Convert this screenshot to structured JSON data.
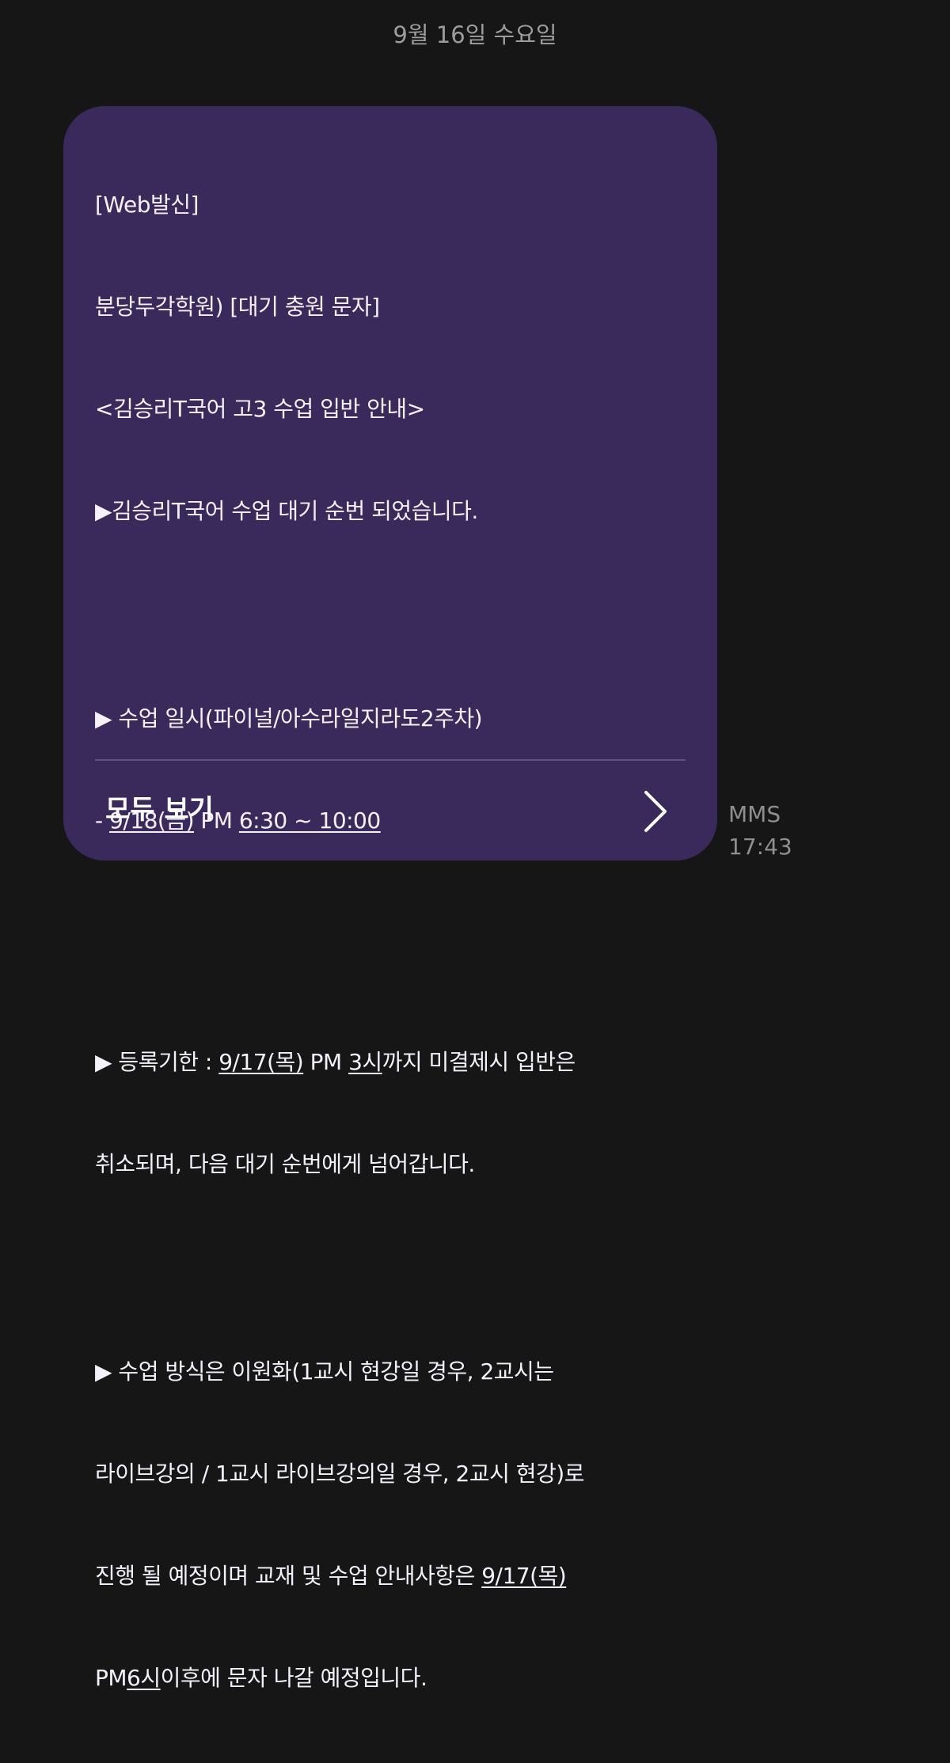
{
  "header": {
    "date": "9월 16일 수요일"
  },
  "message": {
    "line1": "[Web발신]",
    "line2": "분당두각학원) [대기 충원 문자]",
    "line3": "<김승리T국어 고3 수업 입반 안내>",
    "line4": "▶김승리T국어 수업 대기 순번 되었습니다.",
    "line5": "▶ 수업 일시(파이널/아수라일지라도2주차)",
    "line6_prefix": "- ",
    "line6_date": "9/18(금)",
    "line6_mid": " PM ",
    "line6_time": "6:30 ~ 10:00",
    "line7_prefix": "▶ 등록기한 : ",
    "line7_date": "9/17(목)",
    "line7_mid": " PM ",
    "line7_time": "3시",
    "line7_suffix": "까지 미결제시 입반은",
    "line8": "취소되며, 다음 대기 순번에게 넘어갑니다.",
    "line9": "▶ 수업 방식은 이원화(1교시 현강일 경우, 2교시는",
    "line10": "라이브강의 / 1교시 라이브강의일 경우, 2교시 현강)로",
    "line11_prefix": "진행 될 예정이며 교재 및 수업 안내사항은 ",
    "line11_date": "9/17(목)",
    "line12_prefix": "PM",
    "line12_time": "6시",
    "line12_suffix": "이후에 문자 나갈 예정입니다."
  },
  "actions": {
    "view_all_label": "모두 보기",
    "view_all_icon": "chevron-right-icon"
  },
  "meta": {
    "type": "MMS",
    "time": "17:43"
  },
  "colors": {
    "background": "#161616",
    "bubble": "#3a2a5b",
    "text": "#f4f1fb",
    "muted": "#9d9d9d"
  }
}
